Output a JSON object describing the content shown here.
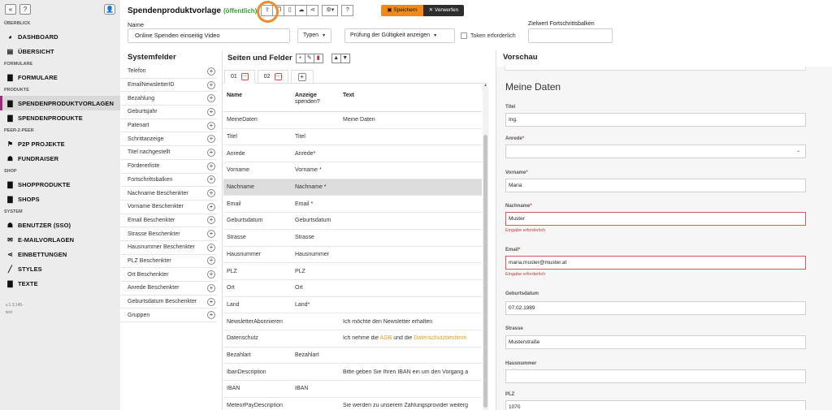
{
  "sidebar": {
    "top_buttons": [
      "«",
      "?",
      "👤"
    ],
    "sections": [
      {
        "title": "ÜBERBLICK",
        "items": [
          {
            "label": "DASHBOARD",
            "icon": "dashboard-icon",
            "glyph": "◕"
          },
          {
            "label": "ÜBERSICHT",
            "icon": "overview-icon",
            "glyph": "▤"
          }
        ]
      },
      {
        "title": "FORMULARE",
        "items": [
          {
            "label": "FORMULARE",
            "icon": "form-icon",
            "glyph": "▇"
          }
        ]
      },
      {
        "title": "PRODUKTE",
        "items": [
          {
            "label": "SPENDENPRODUKTVORLAGEN",
            "icon": "template-icon",
            "glyph": "▇",
            "active": true
          },
          {
            "label": "SPENDENPRODUKTE",
            "icon": "product-icon",
            "glyph": "▇"
          }
        ]
      },
      {
        "title": "PEER-2-PEER",
        "items": [
          {
            "label": "P2P PROJEKTE",
            "icon": "project-icon",
            "glyph": "⚑"
          },
          {
            "label": "FUNDRAISER",
            "icon": "people-icon",
            "glyph": "☗"
          }
        ]
      },
      {
        "title": "SHOP",
        "items": [
          {
            "label": "SHOPPRODUKTE",
            "icon": "shop-product-icon",
            "glyph": "▇"
          },
          {
            "label": "SHOPS",
            "icon": "shop-icon",
            "glyph": "▇"
          }
        ]
      },
      {
        "title": "SYSTEM",
        "items": [
          {
            "label": "BENUTZER (SSO)",
            "icon": "users-icon",
            "glyph": "☗"
          },
          {
            "label": "E-MAILVORLAGEN",
            "icon": "mail-icon",
            "glyph": "✉"
          },
          {
            "label": "EINBETTUNGEN",
            "icon": "share-icon",
            "glyph": "⋖"
          },
          {
            "label": "STYLES",
            "icon": "brush-icon",
            "glyph": "╱"
          },
          {
            "label": "TEXTE",
            "icon": "text-icon",
            "glyph": "▇"
          }
        ]
      }
    ],
    "version_line1": "v.1.3.145-",
    "version_line2": "test"
  },
  "header": {
    "title": "Spendenproduktvorlage",
    "status": "(öffentlich)",
    "toolbar": [
      {
        "name": "publish-button",
        "glyph": "⇪"
      },
      {
        "name": "copy-button",
        "glyph": "❐"
      },
      {
        "name": "document-button",
        "glyph": "▯"
      },
      {
        "name": "upload-button",
        "glyph": "☁"
      },
      {
        "name": "share-button",
        "glyph": "⋖"
      },
      {
        "name": "settings-button",
        "glyph": "⚙▾"
      },
      {
        "name": "help-button",
        "glyph": "?"
      }
    ],
    "save_label": "Speichern",
    "discard_label": "Verwerfen",
    "name_label": "Name",
    "name_value": "Online Spenden einseitig Video",
    "types_label": "Typen",
    "validity_label": "Prüfung der Gültigkeit anzeigen",
    "token_label": "Token erforderlich",
    "progress_label": "Zielwert Fortschrittsbalken"
  },
  "system_fields": {
    "title": "Systemfelder",
    "items": [
      "Telefon",
      "EmailNewsletterID",
      "Bezahlung",
      "Geburtsjahr",
      "Patenart",
      "Schrittanzeige",
      "Titel nachgestellt",
      "Fördererliste",
      "Fortschrittsbalken",
      "Nachname Beschenkter",
      "Vorname Beschenkter",
      "Email Beschenkter",
      "Strasse Beschenkter",
      "Hausnummer Beschenkter",
      "PLZ Beschenkter",
      "Ort Beschenkter",
      "Anrede Beschenkter",
      "Geburtsdatum Beschenkter",
      "Gruppen"
    ]
  },
  "pages": {
    "title": "Seiten und Felder",
    "tabs": [
      "01",
      "02"
    ],
    "columns": {
      "name": "Name",
      "display": "Anzeige",
      "display_sub": "spenden?",
      "text": "Text"
    },
    "rows": [
      {
        "name": "MeineDaten",
        "display": "",
        "text": "Meine Daten"
      },
      {
        "name": "Titel",
        "display": "Titel",
        "text": ""
      },
      {
        "name": "Anrede",
        "display": "Anrede*",
        "text": ""
      },
      {
        "name": "Vorname",
        "display": "Vorname *",
        "text": ""
      },
      {
        "name": "Nachname",
        "display": "Nachname *",
        "text": "",
        "highlight": true
      },
      {
        "name": "Email",
        "display": "Email *",
        "text": ""
      },
      {
        "name": "Geburtsdatum",
        "display": "Geburtsdatum",
        "text": ""
      },
      {
        "name": "Strasse",
        "display": "Strasse",
        "text": ""
      },
      {
        "name": "Hausnummer",
        "display": "Hausnummer",
        "text": ""
      },
      {
        "name": "PLZ",
        "display": "PLZ",
        "text": ""
      },
      {
        "name": "Ort",
        "display": "Ort",
        "text": ""
      },
      {
        "name": "Land",
        "display": "Land*",
        "text": ""
      },
      {
        "name": "NewsletterAbonnieren",
        "display": "",
        "text": "Ich möchte den Newsletter erhalten"
      },
      {
        "name": "Datenschutz",
        "display": "",
        "text_pre": "Ich nehme die ",
        "link1": "AGB",
        "text_mid": " und die ",
        "link2": "Datenschutzbestimm"
      },
      {
        "name": "Bezahlart",
        "display": "Bezahlart",
        "text": ""
      },
      {
        "name": "IbanDescription",
        "display": "",
        "text": "Bitte geben Sie Ihren IBAN ein um den Vorgang a"
      },
      {
        "name": "IBAN",
        "display": "IBAN",
        "text": ""
      },
      {
        "name": "MeteorPayDescription",
        "display": "",
        "text": "Sie werden zu unserem Zahlungsprovider weiterg"
      }
    ]
  },
  "preview": {
    "title": "Vorschau",
    "heading": "Meine Daten",
    "fields": {
      "titel_label": "Titel",
      "titel_value": "Ing.",
      "anrede_label": "Anrede",
      "vorname_label": "Vorname",
      "vorname_value": "Maria",
      "nachname_label": "Nachname",
      "nachname_value": "Muster",
      "nachname_error": "Eingabe erforderlich",
      "email_label": "Email",
      "email_value": "maria.muster@muster.at",
      "email_error": "Eingabe erforderlich",
      "geburtsdatum_label": "Geburtsdatum",
      "geburtsdatum_value": "07.02.1989",
      "strasse_label": "Strasse",
      "strasse_value": "Musterstraße",
      "hausnummer_label": "Hausnummer",
      "plz_label": "PLZ",
      "plz_value": "1070"
    },
    "required_mark": "*"
  },
  "colors": {
    "accent": "#f0891a",
    "public": "#3a9a3a",
    "active_marker": "#9c2c7a",
    "error": "#d45a5a",
    "ring": "#f08a2a"
  }
}
